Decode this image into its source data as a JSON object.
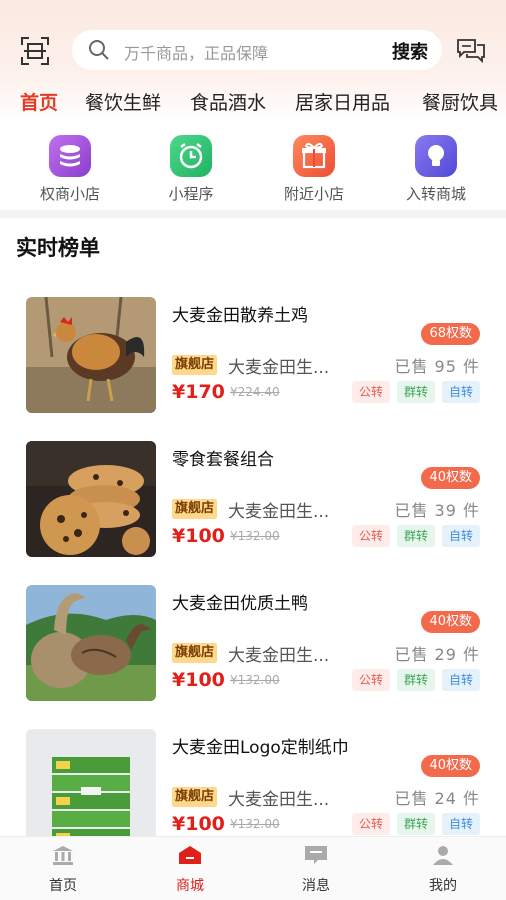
{
  "search": {
    "placeholder": "万千商品，正品保障",
    "button": "搜索"
  },
  "categories": [
    "首页",
    "餐饮生鲜",
    "食品酒水",
    "居家日用品",
    "餐厨饮具"
  ],
  "quick": [
    {
      "label": "权商小店",
      "icon": "coin-stack-icon",
      "color": "#a35ad8"
    },
    {
      "label": "小程序",
      "icon": "alarm-clock-icon",
      "color": "#34c47a"
    },
    {
      "label": "附近小店",
      "icon": "gift-icon",
      "color": "#f26a4b"
    },
    {
      "label": "入转商城",
      "icon": "lightbulb-icon",
      "color": "#6a5be0"
    }
  ],
  "section_title": "实时榜单",
  "products": [
    {
      "name": "大麦金田散养土鸡",
      "badge": "68权数",
      "flag": "旗舰店",
      "shop": "大麦金田生...",
      "sold": "已售 95 件",
      "price": "¥170",
      "old_price": "¥224.40",
      "tags": [
        "公转",
        "群转",
        "自转"
      ]
    },
    {
      "name": "零食套餐组合",
      "badge": "40权数",
      "flag": "旗舰店",
      "shop": "大麦金田生...",
      "sold": "已售 39 件",
      "price": "¥100",
      "old_price": "¥132.00",
      "tags": [
        "公转",
        "群转",
        "自转"
      ]
    },
    {
      "name": "大麦金田优质土鸭",
      "badge": "40权数",
      "flag": "旗舰店",
      "shop": "大麦金田生...",
      "sold": "已售 29 件",
      "price": "¥100",
      "old_price": "¥132.00",
      "tags": [
        "公转",
        "群转",
        "自转"
      ]
    },
    {
      "name": "大麦金田Logo定制纸巾",
      "badge": "40权数",
      "flag": "旗舰店",
      "shop": "大麦金田生...",
      "sold": "已售 24 件",
      "price": "¥100",
      "old_price": "¥132.00",
      "tags": [
        "公转",
        "群转",
        "自转"
      ]
    }
  ],
  "tabs": [
    {
      "label": "首页",
      "icon": "bank-icon"
    },
    {
      "label": "商城",
      "icon": "shop-icon"
    },
    {
      "label": "消息",
      "icon": "message-icon"
    },
    {
      "label": "我的",
      "icon": "profile-icon"
    }
  ],
  "colors": {
    "accent": "#e0201b",
    "badge": "#f26a4b"
  }
}
